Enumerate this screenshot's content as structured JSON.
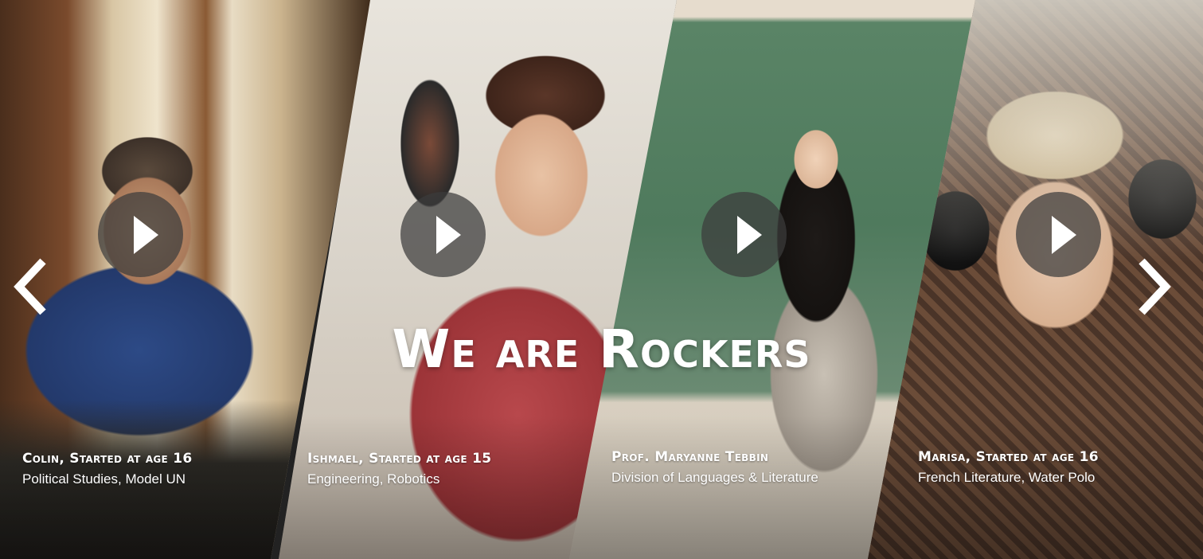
{
  "headline": "We are Rockers",
  "navigation": {
    "prev_icon": "chevron-left-icon",
    "next_icon": "chevron-right-icon"
  },
  "slides": [
    {
      "name": "Colin, Started at age 16",
      "detail": "Political Studies, Model UN",
      "play_icon": "play-icon"
    },
    {
      "name": "Ishmael, Started at age 15",
      "detail": "Engineering, Robotics",
      "play_icon": "play-icon"
    },
    {
      "name": "Prof. Maryanne Tebbin",
      "detail": "Division of Languages & Literature",
      "play_icon": "play-icon"
    },
    {
      "name": "Marisa, Started at age 16",
      "detail": "French Literature, Water Polo",
      "play_icon": "play-icon"
    }
  ],
  "colors": {
    "text": "#ffffff",
    "play_button": "#3c3c3c"
  }
}
